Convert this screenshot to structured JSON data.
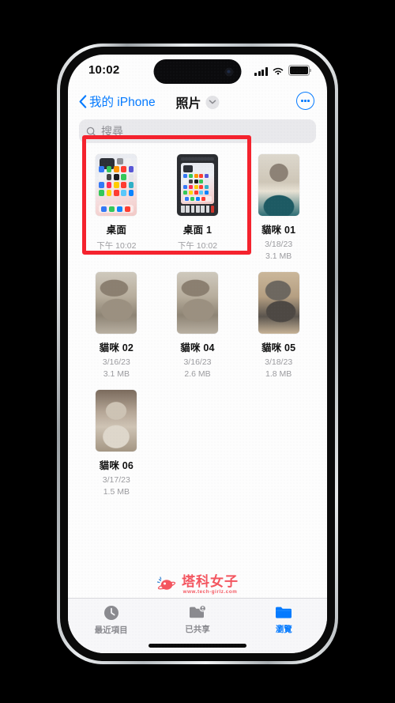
{
  "status_bar": {
    "time": "10:02",
    "icons": [
      "cellular-signal-icon",
      "wifi-icon",
      "battery-icon"
    ]
  },
  "nav_bar": {
    "back_label": "我的 iPhone",
    "back_icon": "chevron-left-icon",
    "title": "照片",
    "title_chevron_icon": "chevron-down-icon",
    "more_icon": "ellipsis-circle-icon"
  },
  "search": {
    "placeholder": "搜尋",
    "value": "",
    "icon": "search-icon"
  },
  "files": [
    {
      "name": "桌面",
      "meta1": "下午 10:02",
      "meta2": "",
      "thumb": "iphone-home-screen-screenshot"
    },
    {
      "name": "桌面 1",
      "meta1": "下午 10:02",
      "meta2": "",
      "thumb": "dark-framed-phone-screenshot"
    },
    {
      "name": "貓咪 01",
      "meta1": "3/18/23",
      "meta2": "3.1 MB",
      "thumb": "cat-photo-1"
    },
    {
      "name": "貓咪 02",
      "meta1": "3/16/23",
      "meta2": "3.1 MB",
      "thumb": "cat-photo-2"
    },
    {
      "name": "貓咪 04",
      "meta1": "3/16/23",
      "meta2": "2.6 MB",
      "thumb": "cat-photo-4"
    },
    {
      "name": "貓咪 05",
      "meta1": "3/18/23",
      "meta2": "1.8 MB",
      "thumb": "cat-photo-5"
    },
    {
      "name": "貓咪 06",
      "meta1": "3/17/23",
      "meta2": "1.5 MB",
      "thumb": "cat-photo-6"
    }
  ],
  "annotation": {
    "color": "#f5222d",
    "covers": [
      "桌面",
      "桌面 1"
    ]
  },
  "watermark": {
    "title": "塔科女子",
    "url": "www.tech-girlz.com",
    "color": "#f4555f"
  },
  "tab_bar": {
    "items": [
      {
        "label": "最近項目",
        "icon": "clock-icon",
        "active": false
      },
      {
        "label": "已共享",
        "icon": "shared-folder-icon",
        "active": false
      },
      {
        "label": "瀏覽",
        "icon": "folder-icon",
        "active": true
      }
    ],
    "active_color": "#047aff",
    "inactive_color": "#8a8a8f"
  }
}
